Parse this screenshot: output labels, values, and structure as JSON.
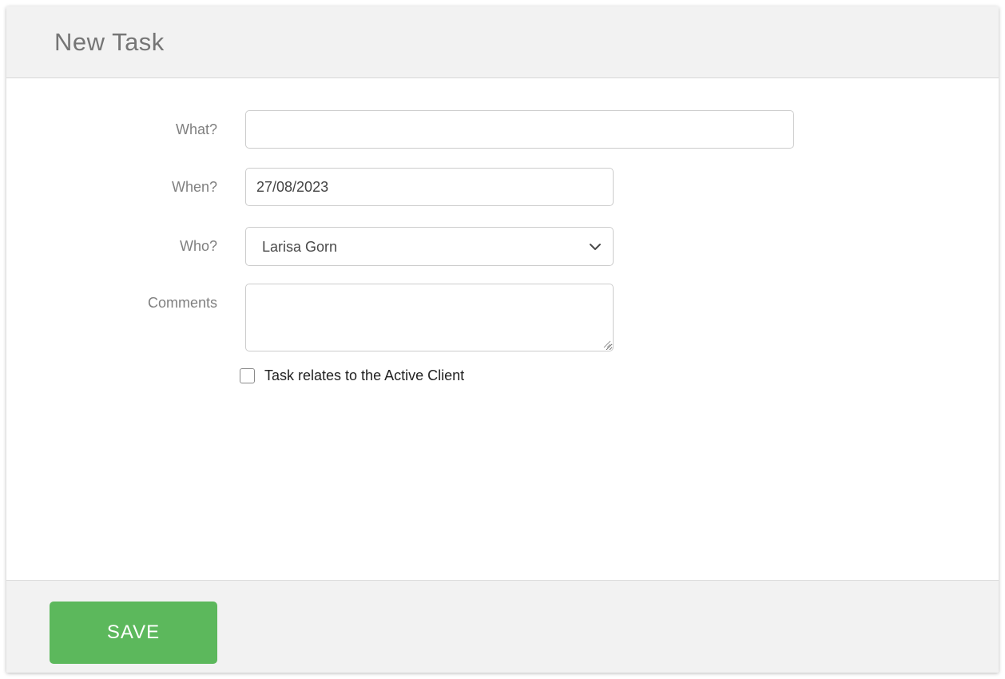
{
  "header": {
    "title": "New Task"
  },
  "form": {
    "what": {
      "label": "What?",
      "value": ""
    },
    "when": {
      "label": "When?",
      "value": "27/08/2023"
    },
    "who": {
      "label": "Who?",
      "value": "Larisa Gorn"
    },
    "comments": {
      "label": "Comments",
      "value": ""
    },
    "active_client_checkbox": {
      "label": "Task relates to the Active Client",
      "checked": false
    }
  },
  "footer": {
    "save_label": "SAVE"
  },
  "icons": {
    "select_chevron": "chevron-down-icon",
    "textarea_grip": "resize-grip-icon"
  },
  "colors": {
    "accent_green": "#5cb85c",
    "panel_bg": "#f2f2f2",
    "panel_border": "#d8d8d8",
    "input_border": "#cccccc",
    "label_text": "#808080",
    "title_text": "#757575"
  }
}
